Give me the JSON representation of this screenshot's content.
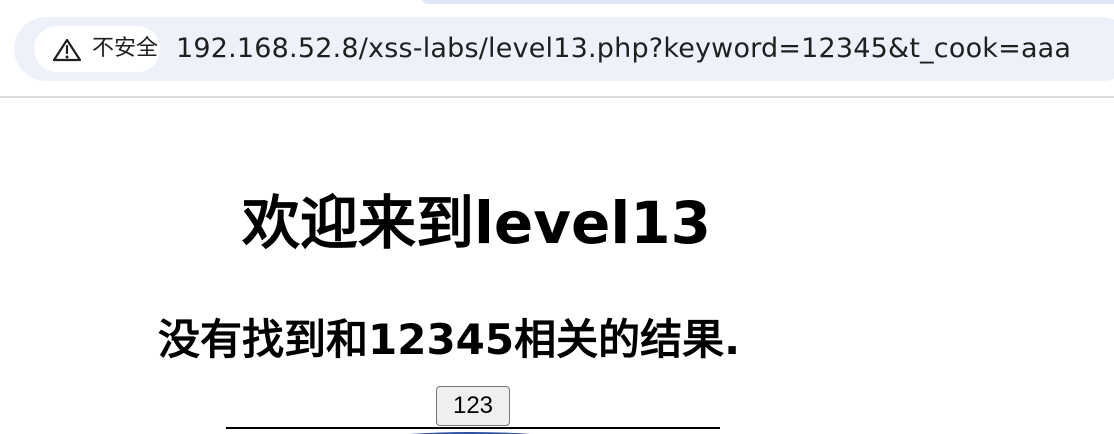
{
  "browser": {
    "security_label": "不安全",
    "url": "192.168.52.8/xss-labs/level13.php?keyword=12345&t_cook=aaa"
  },
  "page": {
    "title": "欢迎来到level13",
    "message": "没有找到和12345相关的结果.",
    "submit_label": "123"
  },
  "colors": {
    "address_bar_background": "#edf2fa",
    "security_chip_background": "#ffffff",
    "page_background": "#ffffff",
    "text": "#000000"
  },
  "icons": {
    "security": "warning-icon",
    "page_image": "partial-logo-image"
  }
}
